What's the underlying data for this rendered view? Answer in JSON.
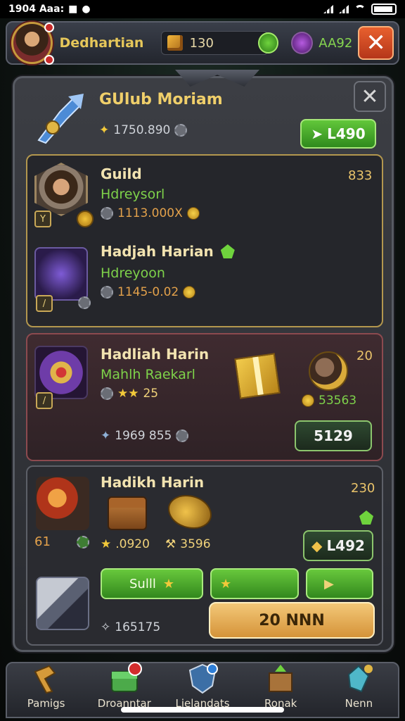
{
  "status": {
    "time": "1904 Aaa:"
  },
  "topbar": {
    "player_name": "Dedhartian",
    "gold_value": "130",
    "gem_value": "AA92"
  },
  "panel": {
    "title": "GUlub Moriam",
    "header_stat": "1750.890",
    "header_button": "L490"
  },
  "guild_card": {
    "entry1": {
      "title": "Guild",
      "subtitle": "Hdreysorl",
      "value": "1113.000X",
      "right": "833"
    },
    "entry2": {
      "title": "Hadjah Harian",
      "subtitle": "Hdreyoon",
      "value": "1145-0.02"
    }
  },
  "event_card": {
    "title": "Hadliah Harin",
    "subtitle": "Mahlh Raekarl",
    "stars": "25",
    "right_num": "20",
    "coin_value": "53563",
    "stat": "1969 855",
    "button": "5129"
  },
  "forge_card": {
    "title": "Hadikh Harin",
    "right_num": "230",
    "level": "61",
    "star_value": ".0920",
    "tool_value": "3596",
    "button_dark": "L492",
    "btn_guild": "Sulll",
    "stat": "165175",
    "gold_button": "20 NNN"
  },
  "nav": [
    {
      "label": "Pamigs",
      "icon": "hammer-icon"
    },
    {
      "label": "Droanntar",
      "icon": "chest-icon"
    },
    {
      "label": "Lielandats",
      "icon": "shield-icon"
    },
    {
      "label": "Ronak",
      "icon": "map-icon"
    },
    {
      "label": "Nenn",
      "icon": "crystal-icon"
    }
  ]
}
